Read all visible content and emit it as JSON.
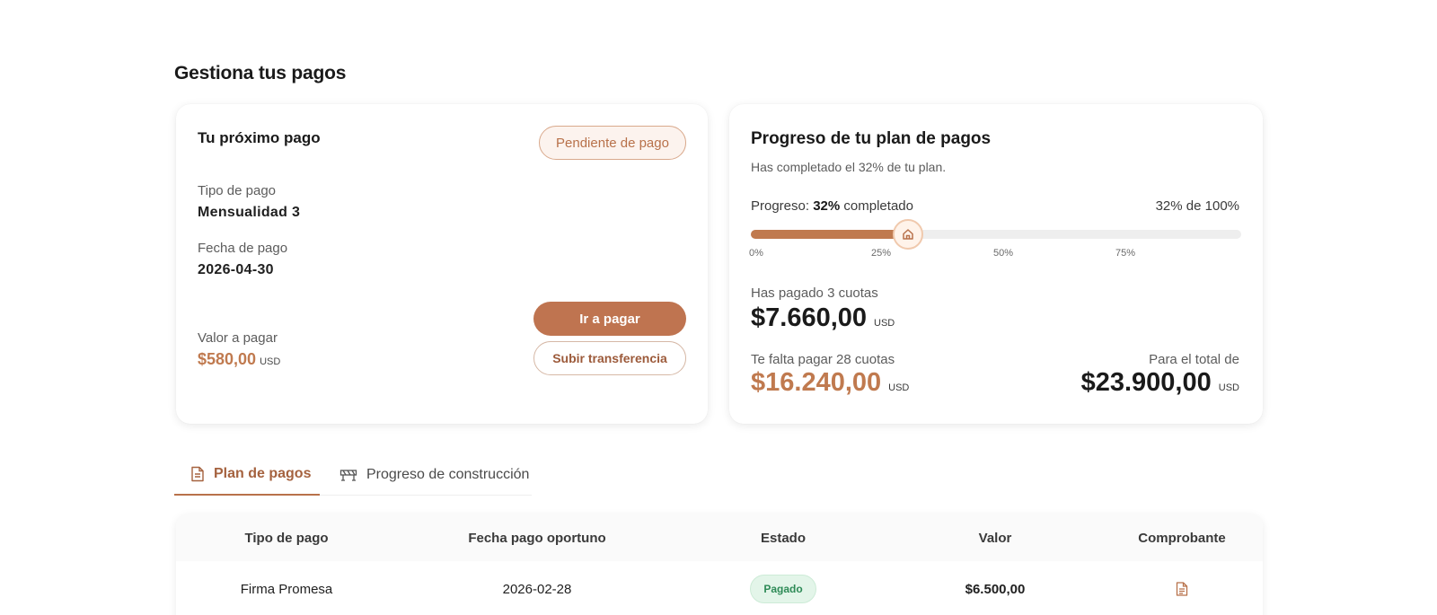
{
  "page": {
    "title": "Gestiona tus pagos"
  },
  "next_payment": {
    "title": "Tu próximo pago",
    "status": "Pendiente de pago",
    "type_label": "Tipo de pago",
    "type_value": "Mensualidad 3",
    "date_label": "Fecha de pago",
    "date_value": "2026-04-30",
    "amount_label": "Valor a pagar",
    "amount_value": "$580,00",
    "amount_unit": "USD",
    "pay_button": "Ir a pagar",
    "upload_button": "Subir transferencia"
  },
  "progress": {
    "title": "Progreso de tu plan de pagos",
    "subtitle": "Has completado el 32% de tu plan.",
    "label_prefix": "Progreso:",
    "label_value": "32%",
    "label_suffix": "completado",
    "of_total": "32% de 100%",
    "percent": 32,
    "ticks": [
      "0%",
      "25%",
      "50%",
      "75%"
    ],
    "paid_label": "Has pagado 3 cuotas",
    "paid_amount": "$7.660,00",
    "remaining_label": "Te falta pagar 28 cuotas",
    "remaining_amount": "$16.240,00",
    "total_label": "Para el total de",
    "total_amount": "$23.900,00",
    "unit": "USD"
  },
  "tabs": [
    {
      "label": "Plan de pagos",
      "icon": "document-icon",
      "active": true
    },
    {
      "label": "Progreso de construcción",
      "icon": "construction-icon",
      "active": false
    }
  ],
  "table": {
    "headers": [
      "Tipo de pago",
      "Fecha pago oportuno",
      "Estado",
      "Valor",
      "Comprobante"
    ],
    "rows": [
      {
        "type": "Firma Promesa",
        "date": "2026-02-28",
        "status": "Pagado",
        "value": "$6.500,00",
        "receipt_icon": "receipt-icon"
      }
    ]
  },
  "colors": {
    "accent": "#c07a4f",
    "accent_dark": "#a5623f",
    "paid_green": "#2e8b57"
  }
}
